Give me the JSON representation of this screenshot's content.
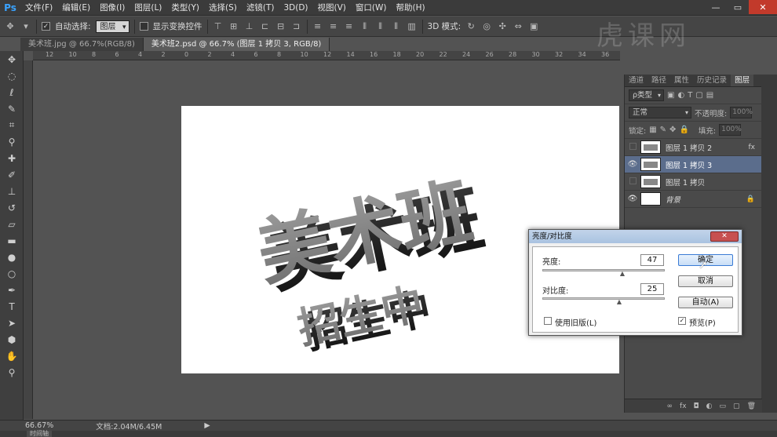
{
  "app": {
    "logo": "Ps"
  },
  "menu": [
    "文件(F)",
    "编辑(E)",
    "图像(I)",
    "图层(L)",
    "类型(Y)",
    "选择(S)",
    "滤镜(T)",
    "3D(D)",
    "视图(V)",
    "窗口(W)",
    "帮助(H)"
  ],
  "window_controls": {
    "minimize": "—",
    "restore": "▭",
    "close": "✕"
  },
  "options": {
    "auto_select_label": "自动选择:",
    "auto_select_value": "图层",
    "show_transform_label": "显示变换控件",
    "mode_3d_label": "3D 模式:"
  },
  "tabs": [
    {
      "label": "美术班.jpg @ 66.7%(RGB/8)",
      "active": false
    },
    {
      "label": "美术班2.psd @ 66.7% (图层 1 拷贝 3, RGB/8)",
      "active": true
    }
  ],
  "ruler_labels": [
    "12",
    "10",
    "8",
    "6",
    "4",
    "2",
    "0",
    "2",
    "4",
    "6",
    "8",
    "10",
    "12",
    "14",
    "16",
    "18",
    "20",
    "22",
    "24",
    "26",
    "28",
    "30",
    "32",
    "34",
    "36"
  ],
  "watermark": "虎课网",
  "artwork": {
    "line1": "美术班",
    "line2": "招生中"
  },
  "panel": {
    "tabs": [
      "通道",
      "路径",
      "属性",
      "历史记录",
      "图层"
    ],
    "filter_label": "ρ类型",
    "blend_mode": "正常",
    "opacity_label": "不透明度:",
    "opacity_value": "100%",
    "lock_label": "锁定:",
    "fill_label": "填充:",
    "fill_value": "100%",
    "layers": [
      {
        "name": "图层 1 拷贝 2",
        "visible": false,
        "selected": false,
        "right": "fx"
      },
      {
        "name": "图层 1 拷贝 3",
        "visible": true,
        "selected": true,
        "right": ""
      },
      {
        "name": "图层 1 拷贝",
        "visible": false,
        "selected": false,
        "right": ""
      },
      {
        "name": "背景",
        "visible": true,
        "selected": false,
        "right": "🔒"
      }
    ]
  },
  "status": {
    "zoom": "66.67%",
    "doc_info": "文档:2.04M/6.45M",
    "timeline": "时间轴"
  },
  "dialog": {
    "title": "亮度/对比度",
    "brightness_label": "亮度:",
    "brightness_value": "47",
    "contrast_label": "对比度:",
    "contrast_value": "25",
    "ok_label": "确定",
    "cancel_label": "取消",
    "auto_label": "自动(A)",
    "legacy_label": "使用旧版(L)",
    "preview_label": "预览(P)",
    "preview_checked": true,
    "legacy_checked": false
  },
  "colors": {
    "accent": "#3a7bd5",
    "selected_layer": "#5b6d8c",
    "close_red": "#c23a2b"
  }
}
